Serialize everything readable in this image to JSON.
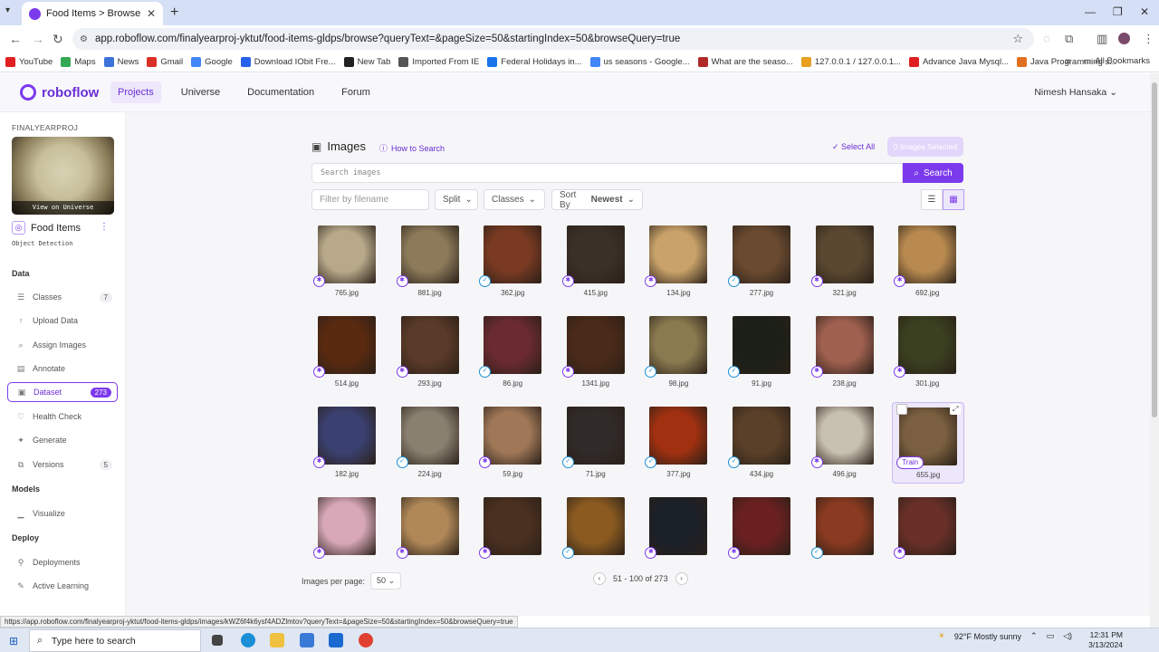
{
  "browser": {
    "tab_title": "Food Items > Browse",
    "url": "app.roboflow.com/finalyearproj-yktut/food-items-gldps/browse?queryText=&pageSize=50&startingIndex=50&browseQuery=true",
    "bookmarks": [
      {
        "label": "YouTube",
        "color": "#e02020"
      },
      {
        "label": "Maps",
        "color": "#34a853"
      },
      {
        "label": "News",
        "color": "#3b73d9"
      },
      {
        "label": "Gmail",
        "color": "#d93025"
      },
      {
        "label": "Google",
        "color": "#4285f4"
      },
      {
        "label": "Download IObit Fre...",
        "color": "#2563eb"
      },
      {
        "label": "New Tab",
        "color": "#222222"
      },
      {
        "label": "Imported From IE",
        "color": "#555555"
      },
      {
        "label": "Federal Holidays in...",
        "color": "#1a73e8"
      },
      {
        "label": "us seasons - Google...",
        "color": "#4285f4"
      },
      {
        "label": "What are the seaso...",
        "color": "#b02a2a"
      },
      {
        "label": "127.0.0.1 / 127.0.0.1...",
        "color": "#e8a020"
      },
      {
        "label": "Advance Java Mysql...",
        "color": "#e02020"
      },
      {
        "label": "Java Programming s...",
        "color": "#e07020"
      }
    ],
    "all_bookmarks": "All Bookmarks",
    "status_url": "https://app.roboflow.com/finalyearproj-yktut/food-items-gldps/images/kWZ6f4k6ysf4ADZlmtov?queryText=&pageSize=50&startingIndex=50&browseQuery=true"
  },
  "header": {
    "logo": "roboflow",
    "nav": [
      "Projects",
      "Universe",
      "Documentation",
      "Forum"
    ],
    "user": "Nimesh Hansaka"
  },
  "sidebar": {
    "workspace": "FINALYEARPROJ",
    "view_on_universe": "View on Universe",
    "project_name": "Food Items",
    "project_type": "Object Detection",
    "sections": {
      "data": "Data",
      "models": "Models",
      "deploy": "Deploy"
    },
    "items": [
      {
        "label": "Classes",
        "icon": "list-icon",
        "count": "7"
      },
      {
        "label": "Upload Data",
        "icon": "upload-icon",
        "count": ""
      },
      {
        "label": "Assign Images",
        "icon": "search-icon",
        "count": ""
      },
      {
        "label": "Annotate",
        "icon": "annotate-icon",
        "count": ""
      },
      {
        "label": "Dataset",
        "icon": "images-icon",
        "count": "273"
      },
      {
        "label": "Health Check",
        "icon": "heart-icon",
        "count": ""
      },
      {
        "label": "Generate",
        "icon": "generate-icon",
        "count": ""
      },
      {
        "label": "Versions",
        "icon": "versions-icon",
        "count": "5"
      },
      {
        "label": "Visualize",
        "icon": "chart-icon",
        "count": ""
      },
      {
        "label": "Deployments",
        "icon": "deploy-icon",
        "count": ""
      },
      {
        "label": "Active Learning",
        "icon": "learning-icon",
        "count": ""
      }
    ]
  },
  "main": {
    "title": "Images",
    "how_to_search": "How to Search",
    "select_all": "Select All",
    "selected": "0 Images Selected",
    "search_placeholder": "Search images",
    "search_button": "Search",
    "filter_placeholder": "Filter by filename",
    "split": "Split",
    "classes": "Classes",
    "sort_by": "Sort By",
    "sort_value": "Newest",
    "images": [
      {
        "name": "765.jpg",
        "badge": "run",
        "color": "#b8a98a"
      },
      {
        "name": "881.jpg",
        "badge": "run",
        "color": "#8c7a5a"
      },
      {
        "name": "362.jpg",
        "badge": "valid",
        "color": "#7a3a22"
      },
      {
        "name": "415.jpg",
        "badge": "run",
        "color": "#3a3028"
      },
      {
        "name": "134.jpg",
        "badge": "run",
        "color": "#c9a26a"
      },
      {
        "name": "277.jpg",
        "badge": "valid",
        "color": "#6a4a30"
      },
      {
        "name": "321.jpg",
        "badge": "run",
        "color": "#5a4830"
      },
      {
        "name": "692.jpg",
        "badge": "run",
        "color": "#b88a50"
      },
      {
        "name": "514.jpg",
        "badge": "run",
        "color": "#5a2a10"
      },
      {
        "name": "293.jpg",
        "badge": "run",
        "color": "#5a3a28"
      },
      {
        "name": "86.jpg",
        "badge": "valid",
        "color": "#6a2a30"
      },
      {
        "name": "1341.jpg",
        "badge": "run",
        "color": "#4a2a18"
      },
      {
        "name": "98.jpg",
        "badge": "valid",
        "color": "#8a7a50"
      },
      {
        "name": "91.jpg",
        "badge": "valid",
        "color": "#1a2018"
      },
      {
        "name": "238.jpg",
        "badge": "run",
        "color": "#a06050"
      },
      {
        "name": "301.jpg",
        "badge": "run",
        "color": "#3a4020"
      },
      {
        "name": "182.jpg",
        "badge": "run",
        "color": "#3a4070"
      },
      {
        "name": "224.jpg",
        "badge": "valid",
        "color": "#8a8070"
      },
      {
        "name": "59.jpg",
        "badge": "run",
        "color": "#a07858"
      },
      {
        "name": "71.jpg",
        "badge": "valid",
        "color": "#302a28"
      },
      {
        "name": "377.jpg",
        "badge": "valid",
        "color": "#a03010"
      },
      {
        "name": "434.jpg",
        "badge": "valid",
        "color": "#5a4028"
      },
      {
        "name": "496.jpg",
        "badge": "run",
        "color": "#c8c0b0"
      },
      {
        "name": "655.jpg",
        "badge": "train",
        "color": "#7a6040"
      },
      {
        "name": "",
        "badge": "run",
        "color": "#d8a8b8"
      },
      {
        "name": "",
        "badge": "run",
        "color": "#b08858"
      },
      {
        "name": "",
        "badge": "run",
        "color": "#4a3020"
      },
      {
        "name": "",
        "badge": "valid",
        "color": "#8a5a20"
      },
      {
        "name": "",
        "badge": "run",
        "color": "#1a2028"
      },
      {
        "name": "",
        "badge": "run",
        "color": "#6a2020"
      },
      {
        "name": "",
        "badge": "valid",
        "color": "#8a3a20"
      },
      {
        "name": "",
        "badge": "run",
        "color": "#6a3028"
      }
    ],
    "train_label": "Train",
    "per_page_label": "Images per page:",
    "per_page_value": "50",
    "range": "51 - 100",
    "of": "of 273"
  },
  "taskbar": {
    "search_placeholder": "Type here to search",
    "weather": "92°F  Mostly sunny",
    "time": "12:31 PM",
    "date": "3/13/2024"
  },
  "colors": {
    "accent": "#7c3aed",
    "valid": "#1a8fd6"
  }
}
